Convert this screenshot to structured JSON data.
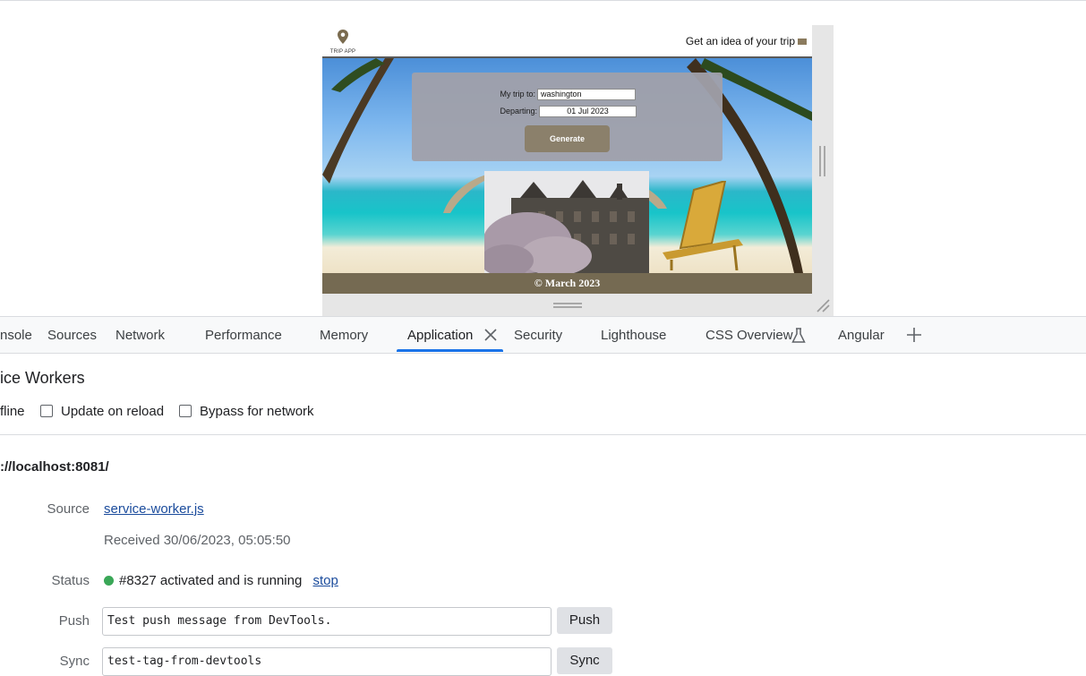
{
  "device": {
    "logo_text": "TRIP APP",
    "header_link": "Get an idea of your trip",
    "form": {
      "destination_label": "My trip to:",
      "destination_value": "washington",
      "departing_label": "Departing:",
      "departing_value": "01 Jul 2023",
      "generate_label": "Generate"
    },
    "footer": "© March 2023"
  },
  "devtools": {
    "tabs": [
      "nsole",
      "Sources",
      "Network",
      "Performance",
      "Memory",
      "Application",
      "Security",
      "Lighthouse",
      "CSS Overview",
      "Angular"
    ],
    "active_tab": "Application",
    "accent_color": "#1a73e8"
  },
  "service_workers": {
    "title": "ice Workers",
    "offline_label": "fline",
    "update_on_reload_label": "Update on reload",
    "bypass_label": "Bypass for network",
    "origin": "://localhost:8081/",
    "source_label": "Source",
    "source_file": "service-worker.js",
    "received": "Received 30/06/2023, 05:05:50",
    "status_label": "Status",
    "status_text": "#8327 activated and is running",
    "status_color": "#3aa757",
    "stop_label": "stop",
    "push_label": "Push",
    "push_value": "Test push message from DevTools.",
    "push_button": "Push",
    "sync_label": "Sync",
    "sync_value": "test-tag-from-devtools",
    "sync_button": "Sync"
  }
}
